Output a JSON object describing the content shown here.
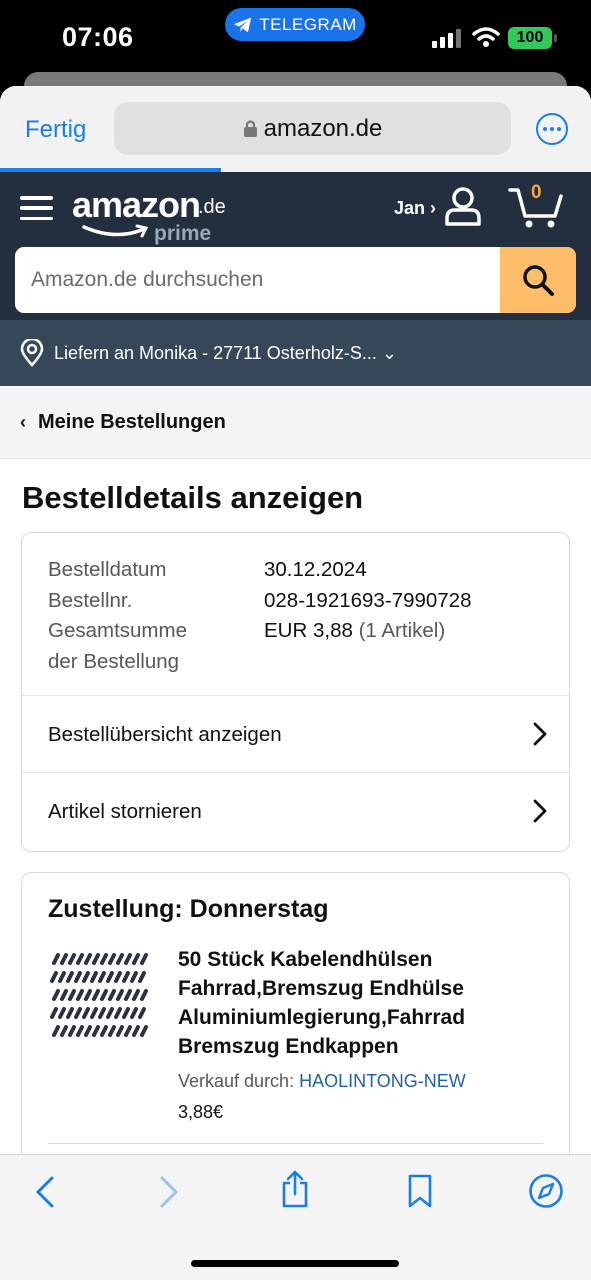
{
  "status_bar": {
    "time": "07:06",
    "pill_label": "TELEGRAM",
    "battery": "100"
  },
  "browser": {
    "done_label": "Fertig",
    "url": "amazon.de"
  },
  "header": {
    "logo_text": "amazon",
    "logo_tld": ".de",
    "logo_prime": "prime",
    "account_label": "Jan ›",
    "cart_count": "0",
    "search_placeholder": "Amazon.de durchsuchen",
    "deliver_to": "Liefern an Monika - 27711 Osterholz-S... ⌄"
  },
  "nav": {
    "back_label": "Meine Bestellungen"
  },
  "page_title": "Bestelldetails anzeigen",
  "order": {
    "date_label": "Bestelldatum",
    "date_value": "30.12.2024",
    "number_label": "Bestellnr.",
    "number_value": "028-1921693-7990728",
    "total_label_1": "Gesamtsumme",
    "total_label_2": "der Bestellung",
    "total_value": "EUR 3,88",
    "total_count": "(1 Artikel)",
    "links": [
      {
        "label": "Bestellübersicht anzeigen"
      },
      {
        "label": "Artikel stornieren"
      }
    ]
  },
  "shipment": {
    "heading": "Zustellung: Donnerstag",
    "item_title": "50 Stück Kabelendhülsen Fahrrad,Bremszug Endhülse Aluminiumlegierung,Fahrrad Bremszug Endkappen",
    "sold_by_label": "Verkauf durch:",
    "seller": "HAOLINTONG-NEW",
    "price": "3,88€"
  },
  "colors": {
    "amazon_dark": "#232f3e",
    "amazon_sub": "#37475a",
    "search_button": "#febd69",
    "ios_blue": "#1a7ee6",
    "link_blue": "#2162a1"
  }
}
